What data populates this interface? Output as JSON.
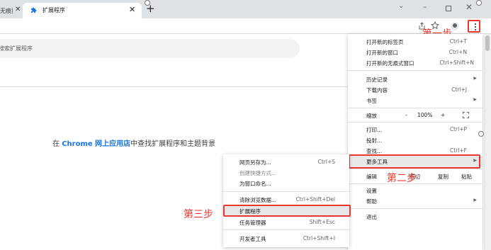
{
  "tabs": {
    "prev_label": "无痕打印",
    "active_label": "扩展程序",
    "close_glyph": "✕",
    "new_tab_glyph": "+"
  },
  "window": {
    "tab_search": "⌄",
    "minimize": "–",
    "close": "✕"
  },
  "page": {
    "search_placeholder": "搜索扩展程序",
    "promo_prefix": "在 ",
    "promo_link": "Chrome 网上应用店",
    "promo_suffix": "中查找扩展程序和主题背景"
  },
  "annotations": {
    "step1": "第一步",
    "step2": "第二步",
    "step3": "第三步"
  },
  "main_menu": {
    "new_tab": "打开新的标签页",
    "new_tab_sc": "Ctrl+T",
    "new_window": "打开新的窗口",
    "new_window_sc": "Ctrl+N",
    "incognito": "打开新的无痕式窗口",
    "incognito_sc": "Ctrl+Shift+N",
    "history": "历史记录",
    "downloads": "下载内容",
    "downloads_sc": "Ctrl+J",
    "bookmarks": "书签",
    "zoom": "缩放",
    "zoom_minus": "-",
    "zoom_value": "100%",
    "zoom_plus": "+",
    "print": "打印...",
    "print_sc": "Ctrl+P",
    "cast": "投射...",
    "find": "查找...",
    "find_sc": "Ctrl+F",
    "more_tools": "更多工具",
    "edit": "编辑",
    "cut": "剪切",
    "copy": "复制",
    "paste": "粘贴",
    "settings": "设置",
    "help": "帮助",
    "exit": "退出"
  },
  "sub_menu": {
    "save_as": "网页另存为...",
    "save_as_sc": "Ctrl+S",
    "create_shortcut": "创建快捷方式...",
    "name_window": "为窗口命名...",
    "clear_data": "清除浏览数据...",
    "clear_data_sc": "Ctrl+Shift+Del",
    "extensions": "扩展程序",
    "task_manager": "任务管理器",
    "task_manager_sc": "Shift+Esc",
    "dev_tools": "开发者工具",
    "dev_tools_sc": "Ctrl+Shift+I"
  },
  "colors": {
    "annotation_red": "#e8382f",
    "link_blue": "#1a73e8",
    "tabstrip": "#dee1e6"
  }
}
